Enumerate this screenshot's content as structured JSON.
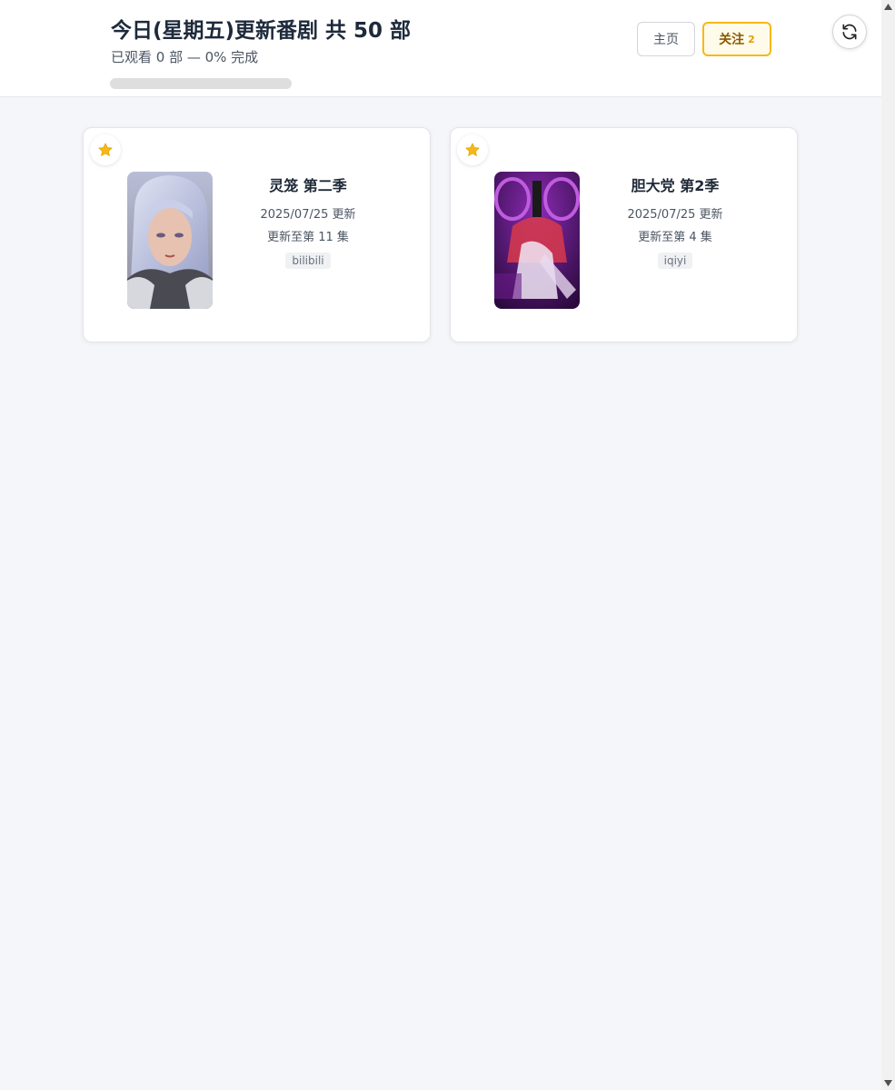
{
  "header": {
    "title": "今日(星期五)更新番剧 共 50 部",
    "subtitle": "已观看 0 部 — 0% 完成",
    "progress_percent": 0,
    "home_label": "主页",
    "follow_label": "关注",
    "follow_count": "2",
    "accent_color": "#f6b818"
  },
  "cards": [
    {
      "name": "灵笼 第二季",
      "date": "2025/07/25 更新",
      "episode": "更新至第 11 集",
      "platform": "bilibili",
      "starred": true
    },
    {
      "name": "胆大党 第2季",
      "date": "2025/07/25 更新",
      "episode": "更新至第 4 集",
      "platform": "iqiyi",
      "starred": true
    }
  ],
  "icons": {
    "refresh": "refresh-icon",
    "star": "star-icon"
  }
}
